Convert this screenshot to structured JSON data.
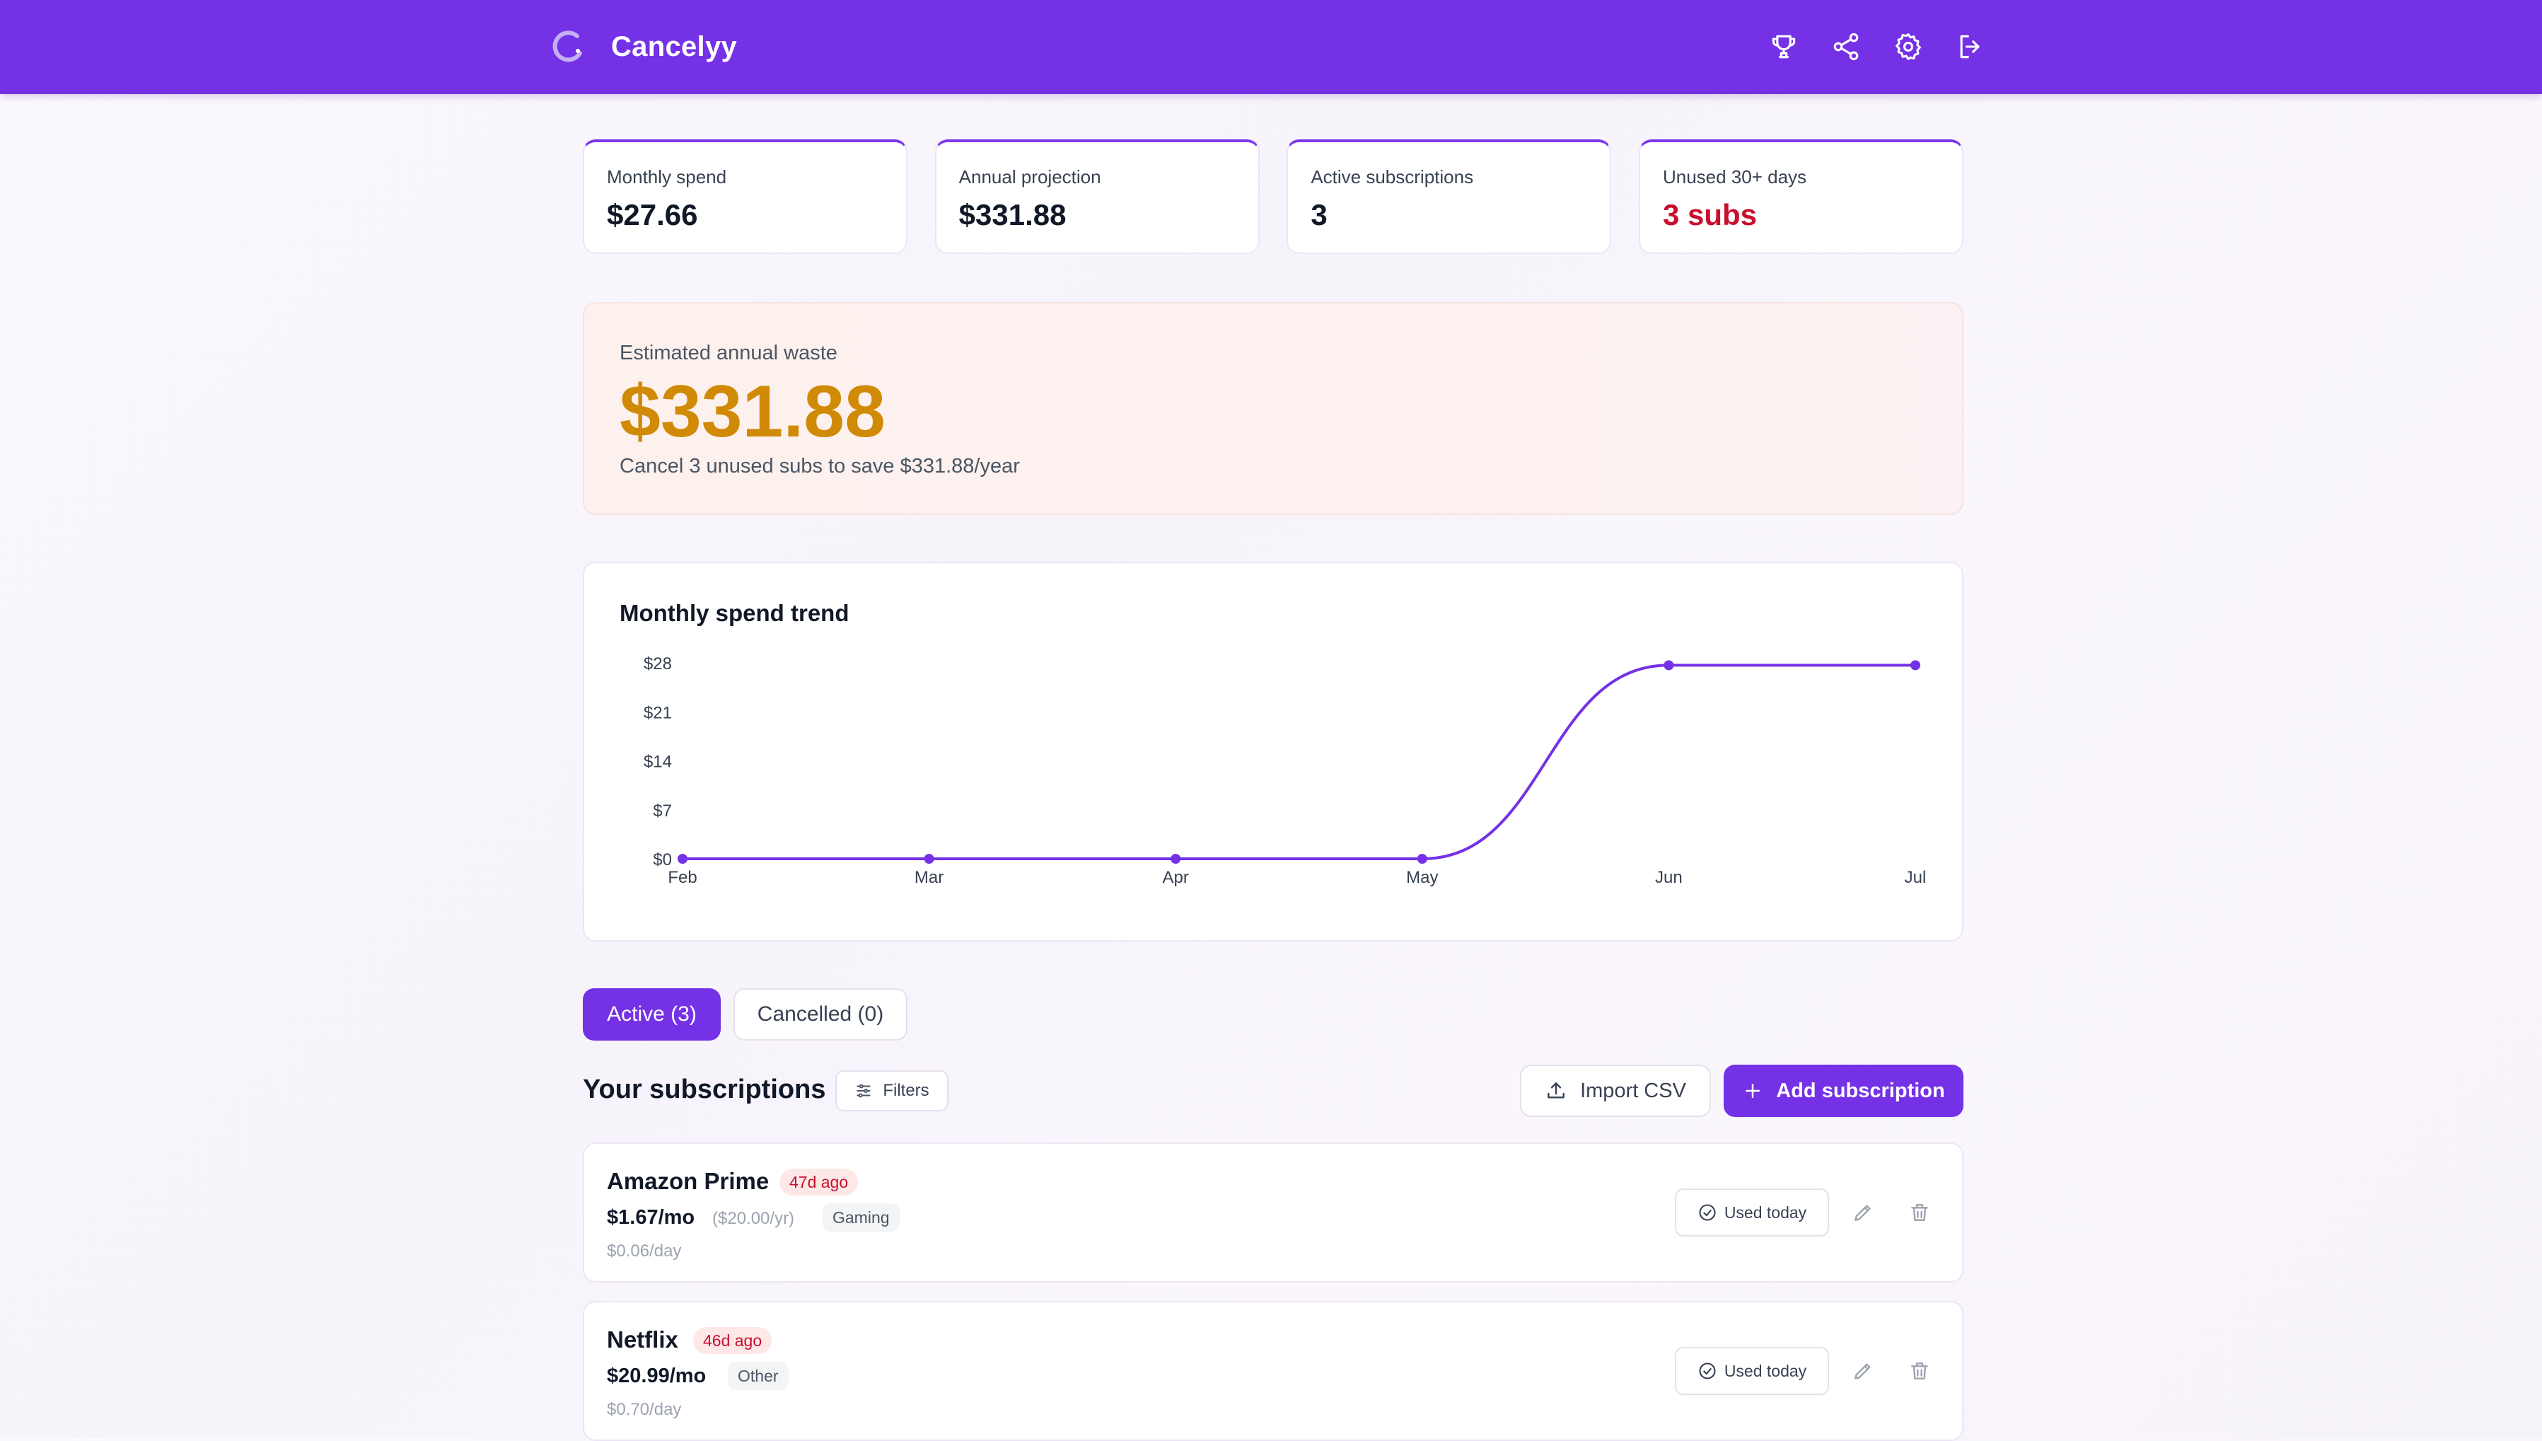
{
  "app": {
    "name": "Cancelyy"
  },
  "nav": {
    "icons": [
      "trophy-icon",
      "share-icon",
      "settings-icon",
      "logout-icon"
    ]
  },
  "stats": [
    {
      "label": "Monthly spend",
      "value": "$27.66",
      "alert": false
    },
    {
      "label": "Annual projection",
      "value": "$331.88",
      "alert": false
    },
    {
      "label": "Active subscriptions",
      "value": "3",
      "alert": false
    },
    {
      "label": "Unused 30+ days",
      "value": "3 subs",
      "alert": true
    }
  ],
  "waste": {
    "label": "Estimated annual waste",
    "amount": "$331.88",
    "subtext": "Cancel 3 unused subs to save $331.88/year"
  },
  "chart_data": {
    "type": "line",
    "title": "Monthly spend trend",
    "categories": [
      "Feb",
      "Mar",
      "Apr",
      "May",
      "Jun",
      "Jul"
    ],
    "values": [
      0,
      0,
      0,
      0,
      27.66,
      27.66
    ],
    "y_ticks": [
      "$0",
      "$7",
      "$14",
      "$21",
      "$28"
    ],
    "ylim": [
      0,
      28
    ],
    "grid": false,
    "color": "#7431e6"
  },
  "tabs": [
    {
      "label": "Active (3)",
      "active": true
    },
    {
      "label": "Cancelled (0)",
      "active": false
    }
  ],
  "subscriptions_header": {
    "title": "Your subscriptions",
    "filters_label": "Filters",
    "import_label": "Import CSV",
    "add_label": "Add subscription"
  },
  "subscriptions": [
    {
      "name": "Amazon Prime",
      "ago": "47d ago",
      "monthly": "$1.67/mo",
      "yearly": "($20.00/yr)",
      "category": "Gaming",
      "daily": "$0.06/day",
      "used_label": "Used today"
    },
    {
      "name": "Netflix",
      "ago": "46d ago",
      "monthly": "$20.99/mo",
      "yearly": "",
      "category": "Other",
      "daily": "$0.70/day",
      "used_label": "Used today"
    }
  ],
  "colors": {
    "primary": "#7431e6",
    "alert": "#c8102e",
    "waste": "#d18a06"
  }
}
